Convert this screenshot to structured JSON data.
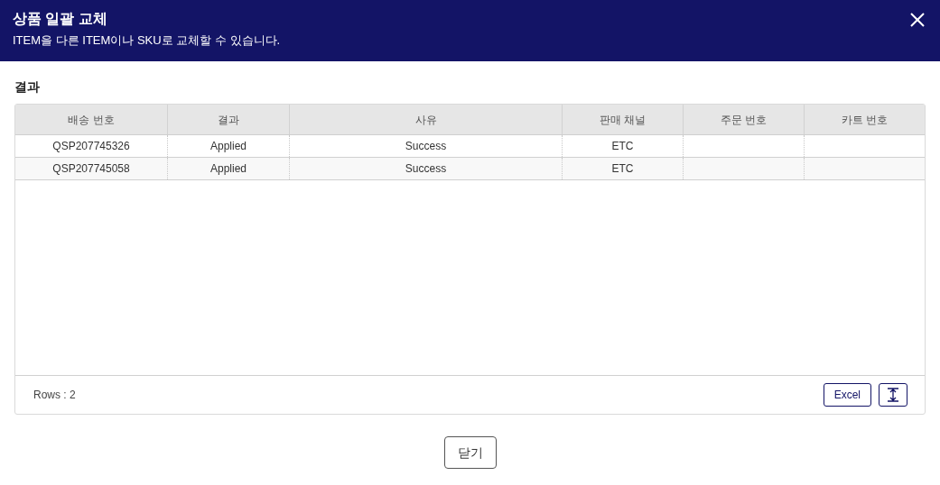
{
  "dialog": {
    "title": "상품 일괄 교체",
    "subtitle": "ITEM을 다른 ITEM이나 SKU로 교체할 수 있습니다."
  },
  "section_title": "결과",
  "table": {
    "columns": [
      "배송 번호",
      "결과",
      "사유",
      "판매 채널",
      "주문 번호",
      "카트 번호"
    ],
    "rows": [
      [
        "QSP207745326",
        "Applied",
        "Success",
        "ETC",
        "",
        ""
      ],
      [
        "QSP207745058",
        "Applied",
        "Success",
        "ETC",
        "",
        ""
      ]
    ]
  },
  "footer": {
    "rows_count": "Rows : 2",
    "excel_button": "Excel"
  },
  "close_button": "닫기"
}
